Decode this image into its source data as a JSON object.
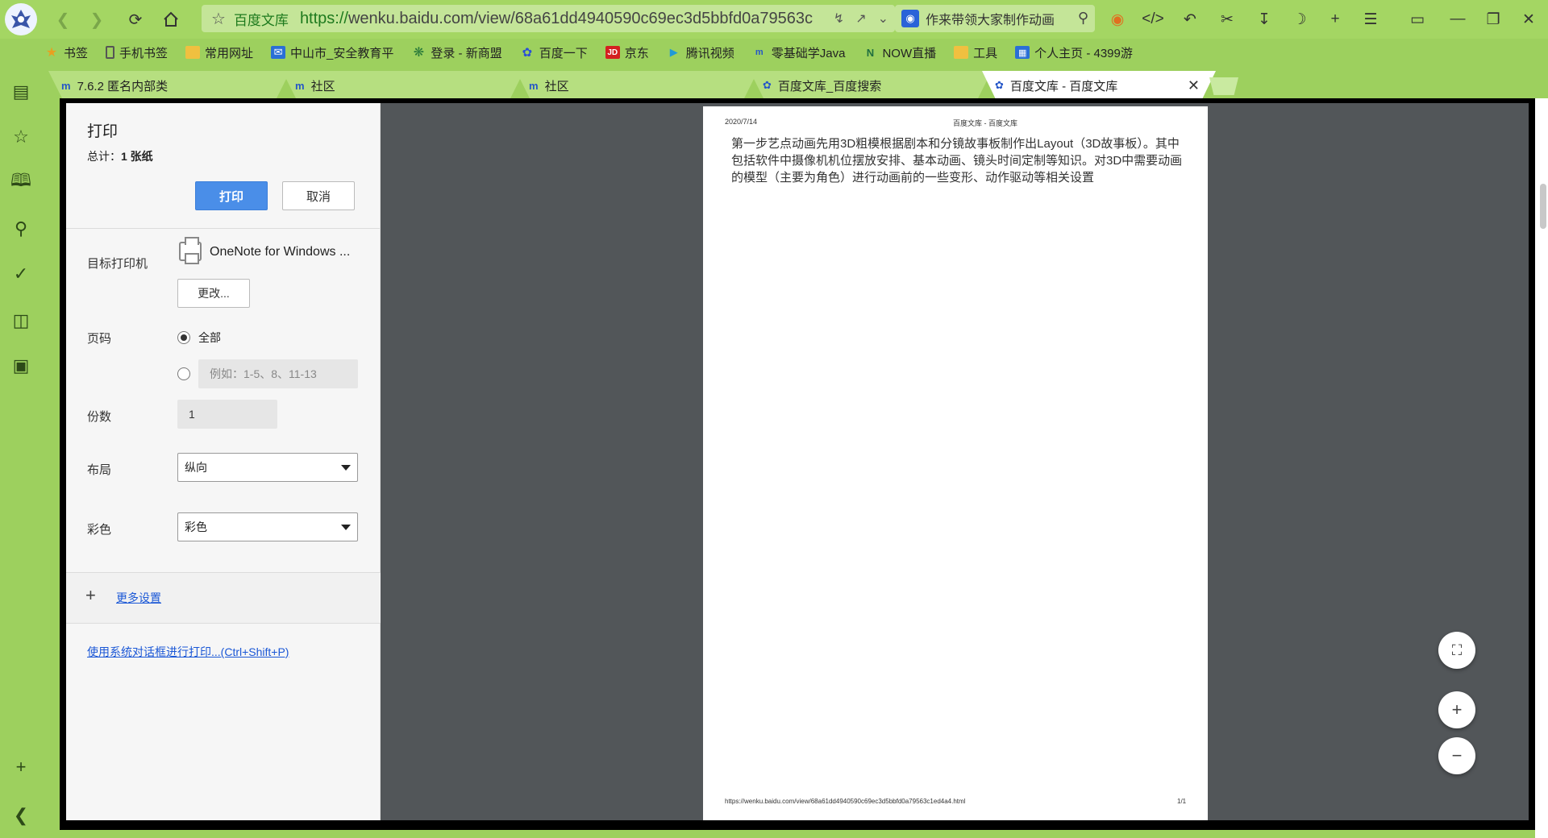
{
  "browser": {
    "url_site_name": "百度文库",
    "url_protocol": "https://",
    "url_rest": "wenku.baidu.com/view/68a61dd4940590c69ec3d5bbfd0a79563c",
    "search_text": "作来带领大家制作动画"
  },
  "bookmarks": [
    {
      "label": "书签",
      "icon": "star-icon"
    },
    {
      "label": "手机书签",
      "icon": "phone-icon"
    },
    {
      "label": "常用网址",
      "icon": "folder-icon"
    },
    {
      "label": "中山市_安全教育平",
      "icon": "mail-icon"
    },
    {
      "label": "登录 - 新商盟",
      "icon": "gear-icon"
    },
    {
      "label": "百度一下",
      "icon": "paw-icon"
    },
    {
      "label": "京东",
      "icon": "jd-icon"
    },
    {
      "label": "腾讯视频",
      "icon": "play-icon"
    },
    {
      "label": "零基础学Java",
      "icon": "mm-icon"
    },
    {
      "label": "NOW直播",
      "icon": "now-icon"
    },
    {
      "label": "工具",
      "icon": "folder-icon"
    },
    {
      "label": "个人主页 - 4399游",
      "icon": "grid-icon"
    }
  ],
  "tabs": [
    {
      "label": "7.6.2 匿名内部类",
      "icon": "mm-icon"
    },
    {
      "label": "社区",
      "icon": "mm-icon"
    },
    {
      "label": "社区",
      "icon": "mm-icon"
    },
    {
      "label": "百度文库_百度搜索",
      "icon": "paw-icon"
    },
    {
      "label": "百度文库 - 百度文库",
      "icon": "paw-icon",
      "active": true
    }
  ],
  "print": {
    "title": "打印",
    "total_label": "总计：",
    "total_value": "1 张纸",
    "print_button": "打印",
    "cancel_button": "取消",
    "printer_label": "目标打印机",
    "printer_name": "OneNote for Windows ...",
    "change_button": "更改...",
    "pages_label": "页码",
    "pages_all": "全部",
    "pages_custom_placeholder": "例如：1-5、8、11-13",
    "copies_label": "份数",
    "copies_value": "1",
    "layout_label": "布局",
    "layout_value": "纵向",
    "color_label": "彩色",
    "color_value": "彩色",
    "more_settings": "更多设置",
    "system_dialog_link": "使用系统对话框进行打印...(Ctrl+Shift+P)"
  },
  "preview": {
    "header_date": "2020/7/14",
    "header_title": "百度文库 - 百度文库",
    "body": "第一步艺点动画先用3D粗模根据剧本和分镜故事板制作出Layout（3D故事板）。其中包括软件中摄像机机位摆放安排、基本动画、镜头时间定制等知识。对3D中需要动画的模型（主要为角色）进行动画前的一些变形、动作驱动等相关设置",
    "footer_url": "https://wenku.baidu.com/view/68a61dd4940590c69ec3d5bbfd0a79563c1ed4a4.html",
    "footer_page": "1/1"
  },
  "colors": {
    "browser_green": "#a4d663",
    "print_button_blue": "#4a8ee8",
    "preview_bg": "#525659"
  }
}
